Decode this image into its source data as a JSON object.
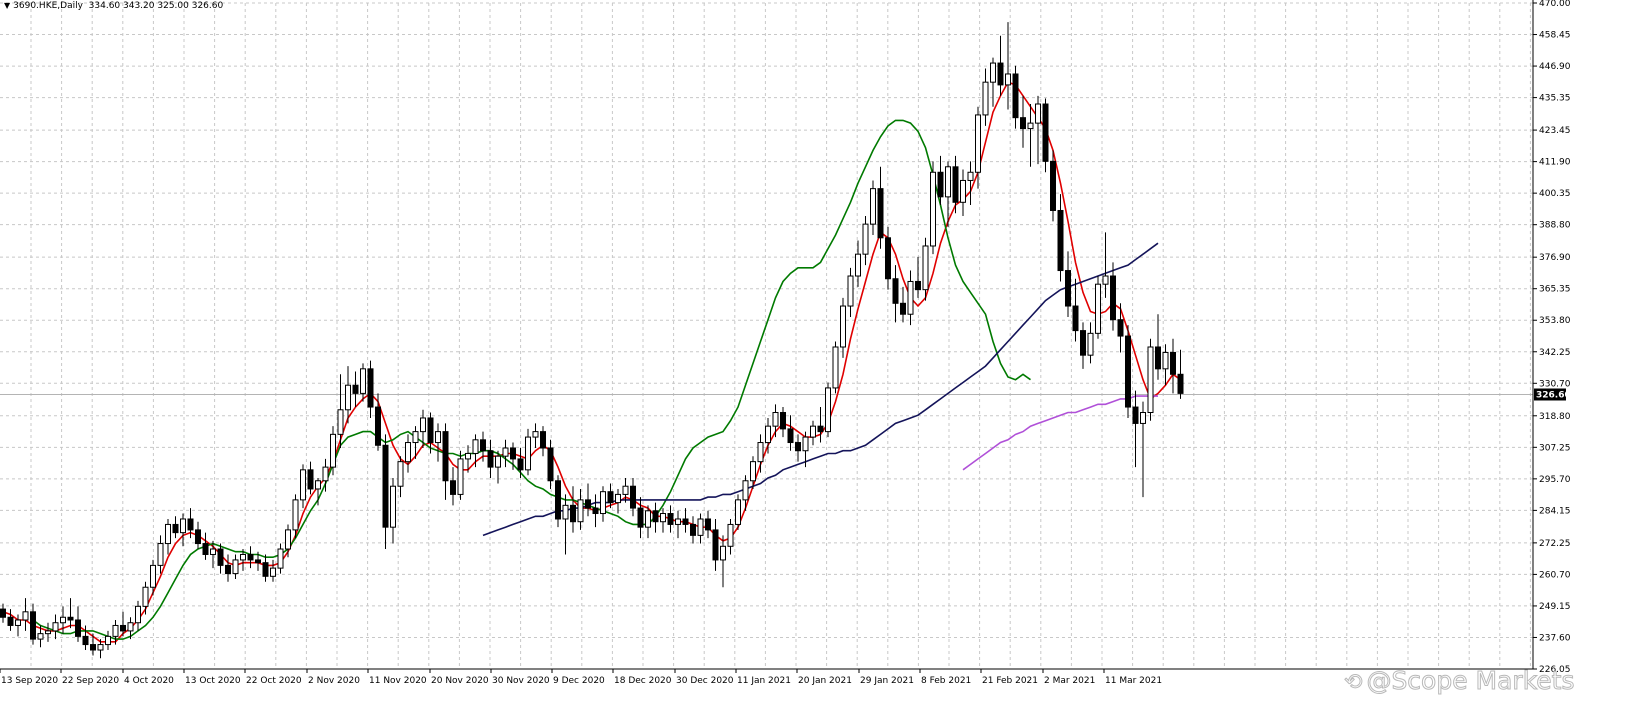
{
  "header": {
    "symbol": "3690.HKE,Daily",
    "ohlc": "334.60 343.20 325.00 326.60"
  },
  "watermark": {
    "text": "@Scope Markets",
    "icon": "weibo-icon"
  },
  "colors": {
    "background": "#ffffff",
    "grid": "#c8c8c8",
    "candle": "#000000",
    "ma_fast": "#e00000",
    "ma_mid": "#007a00",
    "ma_slow": "#14145a",
    "ma_long": "#b050d8",
    "last_price_bg": "#000000",
    "last_price_text": "#ffffff"
  },
  "chart_data": {
    "type": "candlestick",
    "title": "3690.HKE,Daily",
    "last_price": 326.6,
    "ylim": [
      226.05,
      470.0
    ],
    "y_ticks": [
      470.0,
      458.45,
      446.9,
      435.35,
      423.45,
      411.9,
      400.35,
      388.8,
      376.9,
      365.35,
      353.8,
      342.25,
      330.7,
      318.8,
      307.25,
      295.7,
      284.15,
      272.25,
      260.7,
      249.15,
      237.6,
      226.05
    ],
    "x_labels": [
      "13 Sep 2020",
      "22 Sep 2020",
      "4 Oct 2020",
      "13 Oct 2020",
      "22 Oct 2020",
      "2 Nov 2020",
      "11 Nov 2020",
      "20 Nov 2020",
      "30 Nov 2020",
      "9 Dec 2020",
      "18 Dec 2020",
      "30 Dec 2020",
      "11 Jan 2021",
      "20 Jan 2021",
      "29 Jan 2021",
      "8 Feb 2021",
      "21 Feb 2021",
      "2 Mar 2021",
      "11 Mar 2021"
    ],
    "grid": true,
    "candles": [
      [
        248,
        250,
        243,
        245
      ],
      [
        245,
        248,
        240,
        242
      ],
      [
        242,
        246,
        238,
        244
      ],
      [
        244,
        252,
        240,
        247
      ],
      [
        247,
        250,
        235,
        237
      ],
      [
        237,
        242,
        234,
        239
      ],
      [
        239,
        243,
        236,
        240
      ],
      [
        240,
        246,
        237,
        243
      ],
      [
        243,
        249,
        239,
        245
      ],
      [
        245,
        252,
        241,
        244
      ],
      [
        244,
        249,
        236,
        238
      ],
      [
        238,
        242,
        233,
        235
      ],
      [
        235,
        239,
        231,
        233
      ],
      [
        233,
        237,
        230,
        235
      ],
      [
        235,
        240,
        233,
        238
      ],
      [
        238,
        244,
        235,
        242
      ],
      [
        242,
        247,
        238,
        240
      ],
      [
        240,
        245,
        237,
        243
      ],
      [
        243,
        251,
        240,
        249
      ],
      [
        249,
        258,
        246,
        256
      ],
      [
        256,
        266,
        253,
        264
      ],
      [
        264,
        275,
        261,
        272
      ],
      [
        272,
        281,
        268,
        279
      ],
      [
        279,
        282,
        274,
        276
      ],
      [
        276,
        283,
        271,
        281
      ],
      [
        281,
        285,
        274,
        277
      ],
      [
        277,
        280,
        270,
        272
      ],
      [
        272,
        276,
        266,
        268
      ],
      [
        268,
        273,
        263,
        270
      ],
      [
        270,
        272,
        261,
        264
      ],
      [
        264,
        268,
        258,
        261
      ],
      [
        261,
        268,
        259,
        266
      ],
      [
        266,
        270,
        262,
        268
      ],
      [
        268,
        271,
        263,
        266
      ],
      [
        266,
        269,
        262,
        265
      ],
      [
        265,
        268,
        258,
        260
      ],
      [
        260,
        266,
        258,
        263
      ],
      [
        263,
        272,
        261,
        270
      ],
      [
        270,
        279,
        267,
        277
      ],
      [
        277,
        290,
        274,
        288
      ],
      [
        288,
        301,
        285,
        299
      ],
      [
        299,
        302,
        290,
        292
      ],
      [
        292,
        296,
        286,
        295
      ],
      [
        295,
        303,
        291,
        300
      ],
      [
        300,
        315,
        297,
        312
      ],
      [
        312,
        334,
        307,
        321
      ],
      [
        321,
        337,
        316,
        330
      ],
      [
        330,
        335,
        322,
        327
      ],
      [
        327,
        338,
        324,
        336
      ],
      [
        336,
        339,
        318,
        322
      ],
      [
        322,
        327,
        306,
        308
      ],
      [
        308,
        312,
        270,
        278
      ],
      [
        278,
        296,
        272,
        293
      ],
      [
        293,
        304,
        289,
        302
      ],
      [
        302,
        312,
        298,
        309
      ],
      [
        309,
        315,
        303,
        313
      ],
      [
        313,
        321,
        307,
        318
      ],
      [
        318,
        320,
        305,
        309
      ],
      [
        309,
        316,
        302,
        313
      ],
      [
        313,
        316,
        288,
        295
      ],
      [
        295,
        300,
        286,
        290
      ],
      [
        290,
        306,
        288,
        303
      ],
      [
        303,
        308,
        298,
        305
      ],
      [
        305,
        312,
        300,
        310
      ],
      [
        310,
        313,
        302,
        306
      ],
      [
        306,
        310,
        296,
        300
      ],
      [
        300,
        306,
        294,
        304
      ],
      [
        304,
        310,
        300,
        307
      ],
      [
        307,
        309,
        299,
        303
      ],
      [
        303,
        307,
        296,
        299
      ],
      [
        299,
        314,
        297,
        311
      ],
      [
        311,
        316,
        307,
        313
      ],
      [
        313,
        315,
        304,
        307
      ],
      [
        307,
        310,
        292,
        295
      ],
      [
        295,
        297,
        278,
        281
      ],
      [
        281,
        290,
        268,
        286
      ],
      [
        286,
        293,
        276,
        280
      ],
      [
        280,
        292,
        277,
        288
      ],
      [
        288,
        294,
        282,
        285
      ],
      [
        285,
        290,
        278,
        283
      ],
      [
        283,
        293,
        280,
        291
      ],
      [
        291,
        294,
        285,
        287
      ],
      [
        287,
        292,
        283,
        290
      ],
      [
        290,
        296,
        287,
        293
      ],
      [
        293,
        296,
        282,
        285
      ],
      [
        285,
        289,
        274,
        278
      ],
      [
        278,
        286,
        274,
        284
      ],
      [
        284,
        287,
        276,
        280
      ],
      [
        280,
        285,
        276,
        283
      ],
      [
        283,
        286,
        276,
        279
      ],
      [
        279,
        284,
        274,
        281
      ],
      [
        281,
        285,
        276,
        279
      ],
      [
        279,
        282,
        272,
        275
      ],
      [
        275,
        283,
        272,
        281
      ],
      [
        281,
        284,
        274,
        277
      ],
      [
        277,
        281,
        262,
        266
      ],
      [
        266,
        275,
        256,
        271
      ],
      [
        271,
        281,
        268,
        279
      ],
      [
        279,
        290,
        277,
        288
      ],
      [
        288,
        297,
        284,
        295
      ],
      [
        295,
        304,
        292,
        302
      ],
      [
        302,
        312,
        298,
        309
      ],
      [
        309,
        318,
        305,
        315
      ],
      [
        315,
        323,
        311,
        320
      ],
      [
        320,
        322,
        311,
        314
      ],
      [
        314,
        319,
        306,
        309
      ],
      [
        309,
        312,
        302,
        306
      ],
      [
        306,
        313,
        300,
        311
      ],
      [
        311,
        317,
        308,
        315
      ],
      [
        315,
        322,
        309,
        313
      ],
      [
        313,
        331,
        311,
        329
      ],
      [
        329,
        346,
        327,
        344
      ],
      [
        344,
        362,
        340,
        359
      ],
      [
        359,
        373,
        355,
        370
      ],
      [
        370,
        383,
        366,
        378
      ],
      [
        378,
        392,
        374,
        389
      ],
      [
        389,
        405,
        385,
        402
      ],
      [
        402,
        410,
        380,
        384
      ],
      [
        384,
        388,
        365,
        369
      ],
      [
        369,
        374,
        353,
        360
      ],
      [
        360,
        366,
        353,
        356
      ],
      [
        356,
        372,
        352,
        368
      ],
      [
        368,
        377,
        362,
        365
      ],
      [
        365,
        384,
        361,
        381
      ],
      [
        381,
        412,
        378,
        408
      ],
      [
        408,
        414,
        396,
        399
      ],
      [
        399,
        412,
        388,
        410
      ],
      [
        410,
        414,
        393,
        397
      ],
      [
        397,
        409,
        392,
        405
      ],
      [
        405,
        412,
        396,
        408
      ],
      [
        408,
        432,
        402,
        429
      ],
      [
        429,
        446,
        425,
        441
      ],
      [
        441,
        450,
        432,
        448
      ],
      [
        448,
        458,
        436,
        440
      ],
      [
        440,
        463,
        431,
        444
      ],
      [
        444,
        447,
        424,
        428
      ],
      [
        428,
        436,
        417,
        424
      ],
      [
        424,
        433,
        410,
        426
      ],
      [
        426,
        436,
        411,
        433
      ],
      [
        433,
        435,
        408,
        412
      ],
      [
        412,
        416,
        390,
        394
      ],
      [
        394,
        400,
        368,
        372
      ],
      [
        372,
        379,
        355,
        359
      ],
      [
        359,
        369,
        346,
        350
      ],
      [
        350,
        353,
        336,
        341
      ],
      [
        341,
        353,
        338,
        349
      ],
      [
        349,
        370,
        347,
        367
      ],
      [
        367,
        386,
        362,
        370
      ],
      [
        370,
        375,
        350,
        354
      ],
      [
        354,
        360,
        342,
        348
      ],
      [
        348,
        352,
        318,
        322
      ],
      [
        322,
        328,
        300,
        316
      ],
      [
        316,
        324,
        289,
        320
      ],
      [
        320,
        347,
        317,
        344
      ],
      [
        344,
        356,
        332,
        336
      ],
      [
        336,
        345,
        330,
        342
      ],
      [
        342,
        347,
        327,
        334
      ],
      [
        334,
        343,
        325,
        327
      ]
    ],
    "series": [
      {
        "name": "",
        "color": "#e00000",
        "start": 0,
        "values": [
          247,
          246,
          244,
          244,
          242,
          241,
          240,
          240,
          241,
          242,
          242,
          240,
          238,
          236,
          236,
          236,
          239,
          241,
          244,
          248,
          254,
          260,
          267,
          272,
          275,
          276,
          275,
          273,
          271,
          268,
          265,
          264,
          265,
          265,
          265,
          264,
          264,
          265,
          269,
          275,
          283,
          289,
          293,
          296,
          302,
          310,
          318,
          322,
          325,
          327,
          324,
          316,
          308,
          303,
          301,
          304,
          308,
          309,
          307,
          305,
          301,
          299,
          299,
          302,
          304,
          304,
          304,
          305,
          305,
          304,
          303,
          306,
          308,
          306,
          300,
          293,
          288,
          285,
          285,
          284,
          285,
          286,
          287,
          289,
          288,
          286,
          285,
          282,
          282,
          281,
          280,
          280,
          279,
          278,
          278,
          275,
          273,
          274,
          278,
          285,
          293,
          301,
          308,
          313,
          316,
          315,
          313,
          311,
          311,
          312,
          316,
          324,
          334,
          347,
          358,
          368,
          378,
          386,
          384,
          378,
          369,
          362,
          359,
          362,
          371,
          382,
          390,
          396,
          398,
          401,
          408,
          419,
          430,
          436,
          441,
          440,
          436,
          432,
          428,
          424,
          416,
          404,
          390,
          375,
          364,
          357,
          356,
          357,
          360,
          358,
          350,
          341,
          332,
          325,
          327,
          330,
          334,
          332
        ]
      },
      {
        "name": "",
        "color": "#007a00",
        "start": 4,
        "values": [
          244,
          242,
          241,
          240,
          239,
          239,
          240,
          240,
          240,
          239,
          238,
          237,
          237,
          238,
          240,
          242,
          245,
          249,
          254,
          259,
          264,
          268,
          270,
          271,
          272,
          271,
          270,
          269,
          269,
          268,
          268,
          267,
          267,
          268,
          270,
          274,
          279,
          284,
          288,
          294,
          301,
          308,
          311,
          312,
          313,
          313,
          311,
          309,
          310,
          312,
          313,
          311,
          309,
          307,
          306,
          305,
          305,
          304,
          305,
          305,
          306,
          306,
          305,
          303,
          301,
          298,
          295,
          293,
          292,
          290,
          289,
          288,
          288,
          287,
          286,
          285,
          284,
          283,
          282,
          280,
          279,
          279,
          279,
          282,
          286,
          291,
          297,
          303,
          307,
          309,
          311,
          312,
          313,
          317,
          322,
          330,
          338,
          346,
          354,
          362,
          368,
          371,
          373,
          373,
          373,
          375,
          380,
          385,
          391,
          397,
          404,
          410,
          416,
          421,
          425,
          427,
          427,
          426,
          423,
          417,
          407,
          396,
          384,
          374,
          368,
          364,
          360,
          356,
          346,
          338,
          333,
          332,
          334,
          332
        ]
      },
      {
        "name": "",
        "color": "#14145a",
        "start": 64,
        "values": [
          275,
          276,
          277,
          278,
          279,
          280,
          281,
          282,
          282,
          283,
          284,
          284,
          285,
          285,
          286,
          287,
          287,
          287,
          288,
          288,
          288,
          288,
          288,
          288,
          288,
          288,
          288,
          288,
          288,
          288,
          289,
          289,
          290,
          290,
          291,
          292,
          293,
          294,
          296,
          297,
          299,
          300,
          301,
          302,
          303,
          304,
          305,
          305,
          306,
          306,
          307,
          308,
          310,
          312,
          314,
          316,
          317,
          318,
          319,
          321,
          323,
          325,
          327,
          329,
          331,
          333,
          335,
          337,
          340,
          343,
          346,
          349,
          352,
          355,
          358,
          361,
          363,
          365,
          366,
          367,
          368,
          369,
          370,
          371,
          372,
          373,
          374,
          376,
          378,
          380,
          382
        ]
      },
      {
        "name": "",
        "color": "#b050d8",
        "start": 128,
        "values": [
          299,
          301,
          303,
          305,
          307,
          309,
          310,
          312,
          313,
          315,
          316,
          317,
          318,
          319,
          320,
          320,
          321,
          322,
          323,
          323,
          324,
          325,
          325,
          326,
          326,
          326,
          326
        ]
      }
    ],
    "series_x_offset": [
      0,
      0,
      0,
      0
    ]
  }
}
